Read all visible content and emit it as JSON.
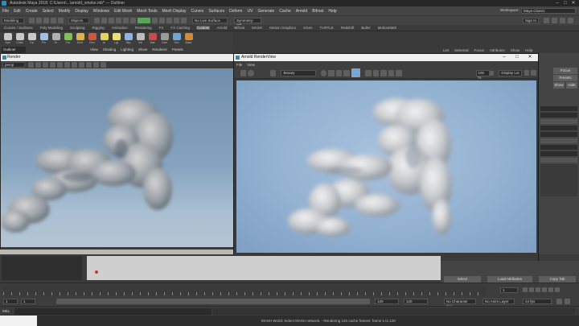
{
  "window": {
    "app_title": "Autodesk Maya 2018: C:\\Users\\...\\arnold_smoke.mb* --- Outliner",
    "minimize": "–",
    "maximize": "□",
    "close": "✕"
  },
  "menubar": {
    "items": [
      "File",
      "Edit",
      "Create",
      "Select",
      "Modify",
      "Display",
      "Windows",
      "Edit Mesh",
      "Mesh Tools",
      "Mesh Display",
      "Curves",
      "Surfaces",
      "Deform",
      "UV",
      "Generate",
      "Cache",
      "Arnold",
      "Bifrost",
      "Help"
    ],
    "workspace_label": "Workspace:",
    "workspace_value": "Maya Classic"
  },
  "statusline": {
    "mode": "Modeling",
    "objects": "Objects",
    "no_live": "No Live Surface",
    "symmetry": "Symmetry: Off",
    "sign_in": "Sign In"
  },
  "shelf_tabs": [
    "Curves / Surfaces",
    "Poly Modeling",
    "Sculpting",
    "Rigging",
    "Animation",
    "Rendering",
    "FX",
    "FX Caching",
    "Custom",
    "Arnold",
    "Bifrost",
    "MASH",
    "Motion Graphics",
    "XGen",
    "TURTLE",
    "Redshift",
    "Bullet",
    "MotionMath"
  ],
  "shelf_active": "Custom",
  "shelf_items": [
    {
      "label": "Sph",
      "color": "#c9c9c9"
    },
    {
      "label": "Cube",
      "color": "#c9c9c9"
    },
    {
      "label": "Cyl",
      "color": "#c9c9c9"
    },
    {
      "label": "Pln",
      "color": "#9ec2e3"
    },
    {
      "label": "Gr",
      "color": "#b0b0b0"
    },
    {
      "label": "Fld",
      "color": "#7fbf5a"
    },
    {
      "label": "Emit",
      "color": "#d9b44a"
    },
    {
      "label": "Ren",
      "color": "#cc5a3a"
    },
    {
      "label": "Ar",
      "color": "#e0d45a"
    },
    {
      "label": "Lgt",
      "color": "#f0e070"
    },
    {
      "label": "Sky",
      "color": "#8bb5e0"
    },
    {
      "label": "Vol",
      "color": "#bdbdbd"
    },
    {
      "label": "Mat",
      "color": "#c84a4a"
    },
    {
      "label": "Cam",
      "color": "#9a9a9a"
    },
    {
      "label": "Sim",
      "color": "#6fa8d8"
    },
    {
      "label": "Bake",
      "color": "#d08a3a"
    }
  ],
  "outliner_label": "Outliner",
  "viewport": {
    "menu": [
      "View",
      "Shading",
      "Lighting",
      "Show",
      "Renderer",
      "Panels"
    ],
    "window_title": "Render",
    "camera": "persp"
  },
  "render_view": {
    "title": "Arnold RenderView",
    "menu": [
      "File",
      "View"
    ],
    "camera": "Beauty",
    "zoom": "100 %",
    "mode": "Display Lut"
  },
  "right_panel": {
    "tabs": [
      "List",
      "Selected",
      "Focus",
      "Attributes",
      "Show",
      "Help"
    ],
    "buttons": [
      "Focus",
      "Presets",
      "Show",
      "Hide"
    ]
  },
  "attr_buttons": [
    "Select",
    "Load Attributes",
    "Copy Tab"
  ],
  "timeline": {
    "start": "1",
    "end": "120",
    "range_start": "1",
    "range_end": "120",
    "current": "1",
    "no_char": "No Character Set",
    "no_anim": "No Anim Layer",
    "fps": "24 fps"
  },
  "help_line": "MASH World: Select MASH network. - Rendering 120 cache frames: frame 1 to 120",
  "cmd_label": "MEL"
}
